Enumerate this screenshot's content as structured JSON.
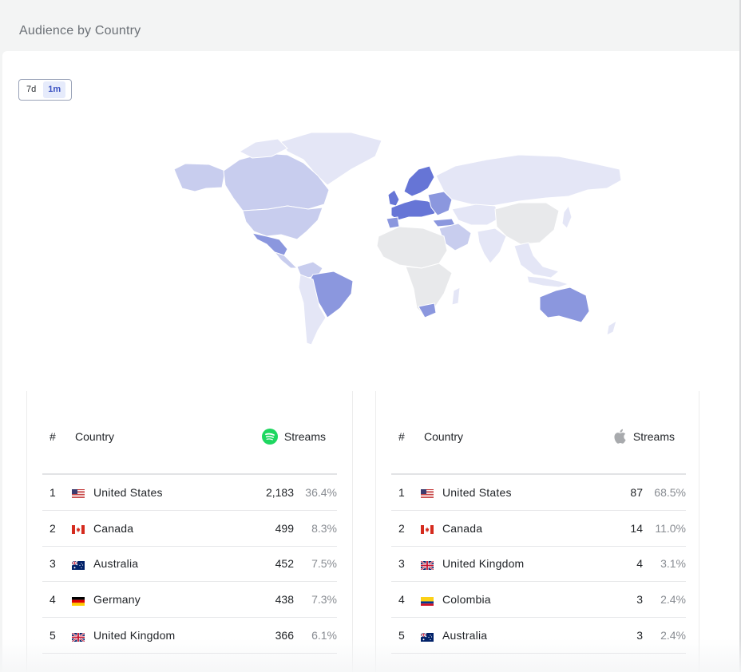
{
  "header": {
    "title": "Audience by Country"
  },
  "period_toggle": {
    "options": [
      "7d",
      "1m"
    ],
    "active": "1m"
  },
  "colors": {
    "map_dark": "#6675d6",
    "map_mid": "#8b97de",
    "map_light": "#c8cdee",
    "map_lighter": "#e4e6f6",
    "map_none": "#e8e9eb",
    "spotify": "#1ed760",
    "apple": "#a8aaad"
  },
  "spotify_table": {
    "headers": {
      "rank": "#",
      "country": "Country",
      "streams": "Streams"
    },
    "service_icon": "spotify-icon",
    "rows": [
      {
        "rank": "1",
        "flag": "us-flag-icon",
        "country": "United States",
        "streams": "2,183",
        "percent": "36.4%"
      },
      {
        "rank": "2",
        "flag": "ca-flag-icon",
        "country": "Canada",
        "streams": "499",
        "percent": "8.3%"
      },
      {
        "rank": "3",
        "flag": "au-flag-icon",
        "country": "Australia",
        "streams": "452",
        "percent": "7.5%"
      },
      {
        "rank": "4",
        "flag": "de-flag-icon",
        "country": "Germany",
        "streams": "438",
        "percent": "7.3%"
      },
      {
        "rank": "5",
        "flag": "gb-flag-icon",
        "country": "United Kingdom",
        "streams": "366",
        "percent": "6.1%"
      }
    ]
  },
  "apple_table": {
    "headers": {
      "rank": "#",
      "country": "Country",
      "streams": "Streams"
    },
    "service_icon": "apple-icon",
    "rows": [
      {
        "rank": "1",
        "flag": "us-flag-icon",
        "country": "United States",
        "streams": "87",
        "percent": "68.5%"
      },
      {
        "rank": "2",
        "flag": "ca-flag-icon",
        "country": "Canada",
        "streams": "14",
        "percent": "11.0%"
      },
      {
        "rank": "3",
        "flag": "gb-flag-icon",
        "country": "United Kingdom",
        "streams": "4",
        "percent": "3.1%"
      },
      {
        "rank": "4",
        "flag": "co-flag-icon",
        "country": "Colombia",
        "streams": "3",
        "percent": "2.4%"
      },
      {
        "rank": "5",
        "flag": "au-flag-icon",
        "country": "Australia",
        "streams": "3",
        "percent": "2.4%"
      }
    ]
  }
}
